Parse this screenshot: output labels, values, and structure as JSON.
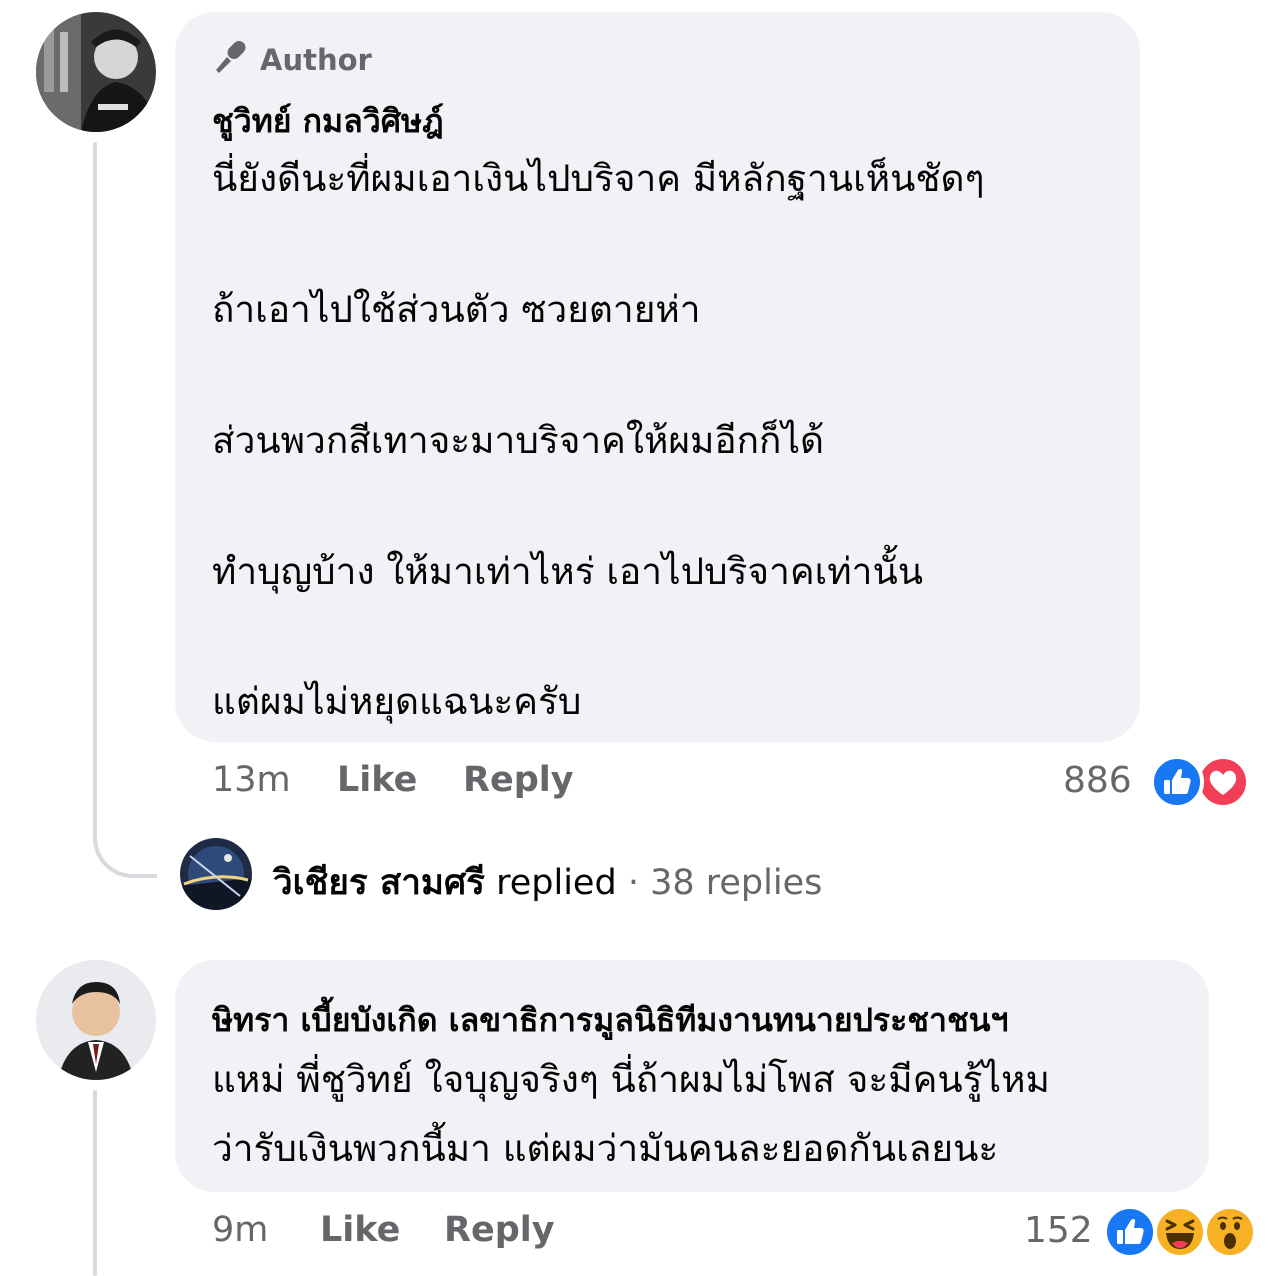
{
  "comment1": {
    "badge": "Author",
    "name": "ชูวิทย์ กมลวิศิษฎ์",
    "lines": [
      "นี่ยังดีนะที่ผมเอาเงินไปบริจาค มีหลักฐานเห็นชัดๆ",
      "ถ้าเอาไปใช้ส่วนตัว ซวยตายห่า",
      "ส่วนพวกสีเทาจะมาบริจาคให้ผมอีกก็ได้",
      "ทำบุญบ้าง ให้มาเท่าไหร่ เอาไปบริจาคเท่านั้น",
      "แต่ผมไม่หยุดแฉนะครับ"
    ],
    "time": "13m",
    "like": "Like",
    "reply": "Reply",
    "reaction_count": "886",
    "reactions": [
      "like-icon",
      "love-icon"
    ]
  },
  "replies_row": {
    "name": "วิเชียร สามศรี",
    "action": "replied",
    "separator": "·",
    "count": "38 replies"
  },
  "comment2": {
    "name": "ษิทรา เบี้ยบังเกิด เลขาธิการมูลนิธิทีมงานทนายประชาชนฯ",
    "lines": [
      "แหม่ พี่ชูวิทย์ ใจบุญจริงๆ นี่ถ้าผมไม่โพส จะมีคนรู้ไหม",
      "ว่ารับเงินพวกนี้มา แต่ผมว่ามันคนละยอดกันเลยนะ"
    ],
    "time": "9m",
    "like": "Like",
    "reply": "Reply",
    "reaction_count": "152",
    "reactions": [
      "like-icon",
      "haha-icon",
      "wow-icon"
    ]
  },
  "colors": {
    "bubble": "#f0f2f5",
    "meta_gray": "#65676b",
    "like_blue": "#1877f2",
    "love_red": "#f33e58",
    "emoji_yellow": "#f7b125"
  }
}
